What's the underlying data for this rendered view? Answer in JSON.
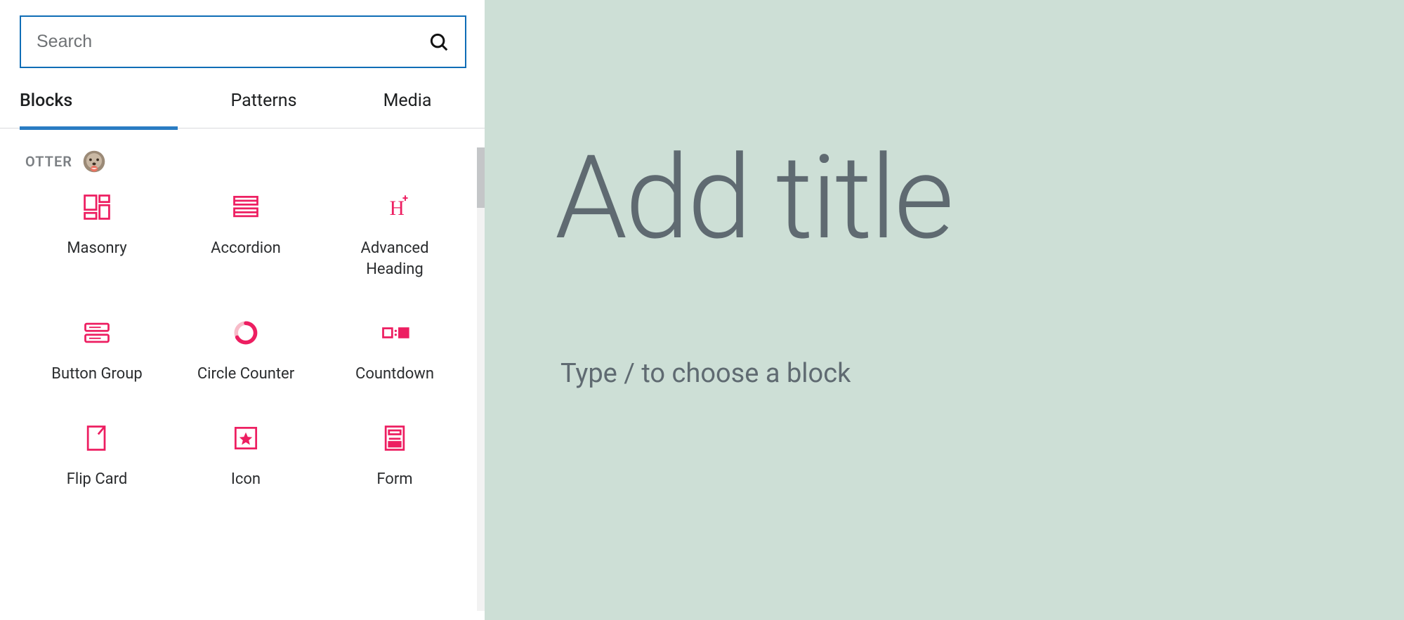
{
  "sidebar": {
    "search": {
      "placeholder": "Search"
    },
    "tabs": [
      {
        "label": "Blocks",
        "active": true
      },
      {
        "label": "Patterns",
        "active": false
      },
      {
        "label": "Media",
        "active": false
      }
    ],
    "category": {
      "label": "OTTER"
    },
    "blocks": [
      {
        "label": "Masonry",
        "icon": "masonry"
      },
      {
        "label": "Accordion",
        "icon": "accordion"
      },
      {
        "label": "Advanced Heading",
        "icon": "advanced-heading"
      },
      {
        "label": "Button Group",
        "icon": "button-group"
      },
      {
        "label": "Circle Counter",
        "icon": "circle-counter"
      },
      {
        "label": "Countdown",
        "icon": "countdown"
      },
      {
        "label": "Flip Card",
        "icon": "flip-card"
      },
      {
        "label": "Icon",
        "icon": "icon-star"
      },
      {
        "label": "Form",
        "icon": "form"
      }
    ]
  },
  "editor": {
    "title_placeholder": "Add title",
    "body_placeholder": "Type / to choose a block"
  },
  "colors": {
    "accent_blue": "#0f6db6",
    "icon_pink": "#ed1e61",
    "canvas_bg": "#cddfd6",
    "text_gray": "#5f6a71"
  }
}
